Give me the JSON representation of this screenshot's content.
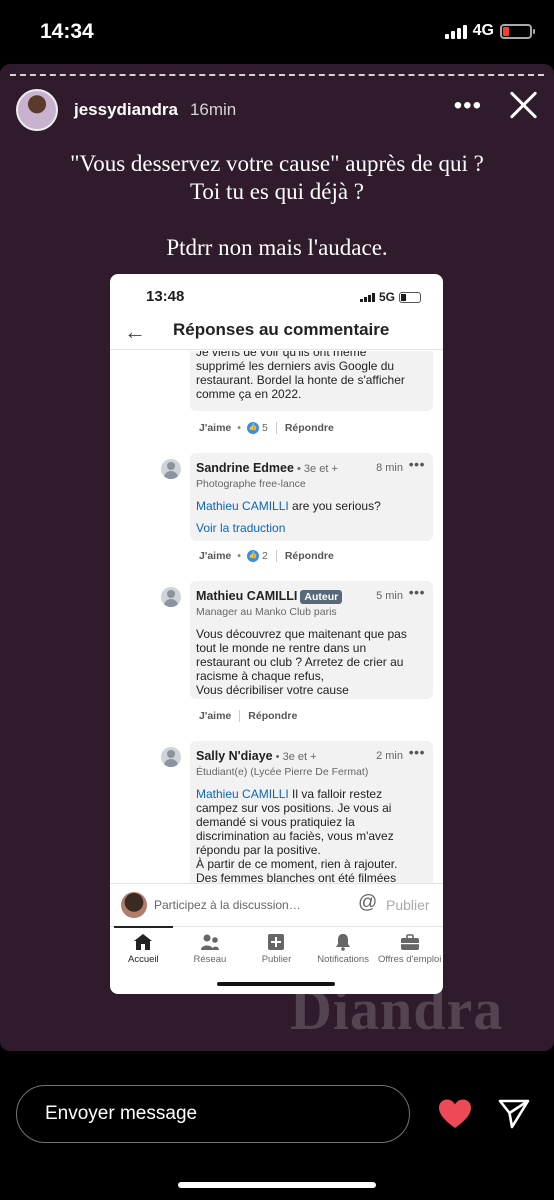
{
  "status": {
    "time": "14:34",
    "network": "4G"
  },
  "story": {
    "username": "jessydiandra",
    "age": "16min",
    "more_label": "•••",
    "caption_1_line1": "\"Vous desservez votre cause\" auprès de qui ?",
    "caption_1_line2": "Toi tu es qui déjà ?",
    "caption_2": "Ptdrr non mais l'audace.",
    "watermark": "Diandra"
  },
  "inner": {
    "status_time": "13:48",
    "network": "5G",
    "title": "Réponses au commentaire",
    "comments": [
      {
        "text": "Je viens de voir qu'ils ont même\nsupprimé les derniers avis Google du\nrestaurant. Bordel la honte de s'afficher\ncomme ça en 2022.",
        "like_label": "J'aime",
        "like_count": "5",
        "reply_label": "Répondre"
      },
      {
        "name": "Sandrine Edmee",
        "meta": " • 3e et +",
        "time": "8 min",
        "role": "Photographe free-lance",
        "mention": "Mathieu CAMILLI",
        "text": " are you serious?",
        "translate": "Voir la traduction",
        "like_label": "J'aime",
        "like_count": "2",
        "reply_label": "Répondre"
      },
      {
        "name": "Mathieu CAMILLI",
        "badge": "Auteur",
        "time": "5 min",
        "role": "Manager au Manko Club paris",
        "text": "Vous découvrez que maitenant que pas\ntout le monde ne rentre dans un\nrestaurant ou club ? Arretez de crier au\nracisme à chaque refus,\nVous décribiliser votre cause",
        "like_label": "J'aime",
        "reply_label": "Répondre"
      },
      {
        "name": "Sally N'diaye",
        "meta": " • 3e et +",
        "time": "2 min",
        "role": "Étudiant(e) (Lycée Pierre De Fermat)",
        "mention": "Mathieu CAMILLI",
        "text": " Il va falloir restez\ncampez sur vos positions. Je vous ai\ndemandé si vous pratiquiez la\ndiscrimination au faciès, vous m'avez\nrépondu par la positive.\nÀ partir de ce moment, rien à rajouter.\nDes femmes blanches ont été filmées"
      }
    ],
    "input_placeholder": "Participez à la discussion…",
    "publish_label": "Publier",
    "tabs": [
      {
        "label": "Accueil",
        "icon": "home-icon"
      },
      {
        "label": "Réseau",
        "icon": "network-icon"
      },
      {
        "label": "Publier",
        "icon": "plus-icon"
      },
      {
        "label": "Notifications",
        "icon": "bell-icon"
      },
      {
        "label": "Offres d'emploi",
        "icon": "briefcase-icon"
      }
    ]
  },
  "reply": {
    "placeholder": "Envoyer message"
  },
  "colors": {
    "story_bg": "#2f1b2c",
    "link": "#0a66c2",
    "heart": "#ed4956",
    "battery_low": "#ff3b30"
  }
}
